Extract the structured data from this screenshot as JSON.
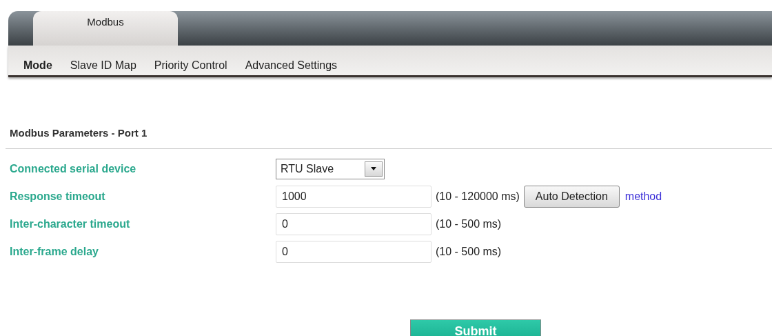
{
  "tabs": [
    {
      "label": "Modbus",
      "selected": true
    }
  ],
  "subtabs": [
    {
      "label": "Mode",
      "selected": true
    },
    {
      "label": "Slave ID Map",
      "selected": false
    },
    {
      "label": "Priority Control",
      "selected": false
    },
    {
      "label": "Advanced Settings",
      "selected": false
    }
  ],
  "section": {
    "title": "Modbus Parameters - Port 1"
  },
  "fields": [
    {
      "kind": "select",
      "label": "Connected serial device",
      "value": "RTU Slave"
    },
    {
      "kind": "text",
      "label": "Response timeout",
      "value": "1000",
      "range": "(10 - 120000 ms)",
      "button": "Auto Detection",
      "link": "method"
    },
    {
      "kind": "text",
      "label": "Inter-character timeout",
      "value": "0",
      "range": "(10 - 500 ms)"
    },
    {
      "kind": "text",
      "label": "Inter-frame delay",
      "value": "0",
      "range": "(10 - 500 ms)"
    }
  ],
  "submit": "Submit"
}
